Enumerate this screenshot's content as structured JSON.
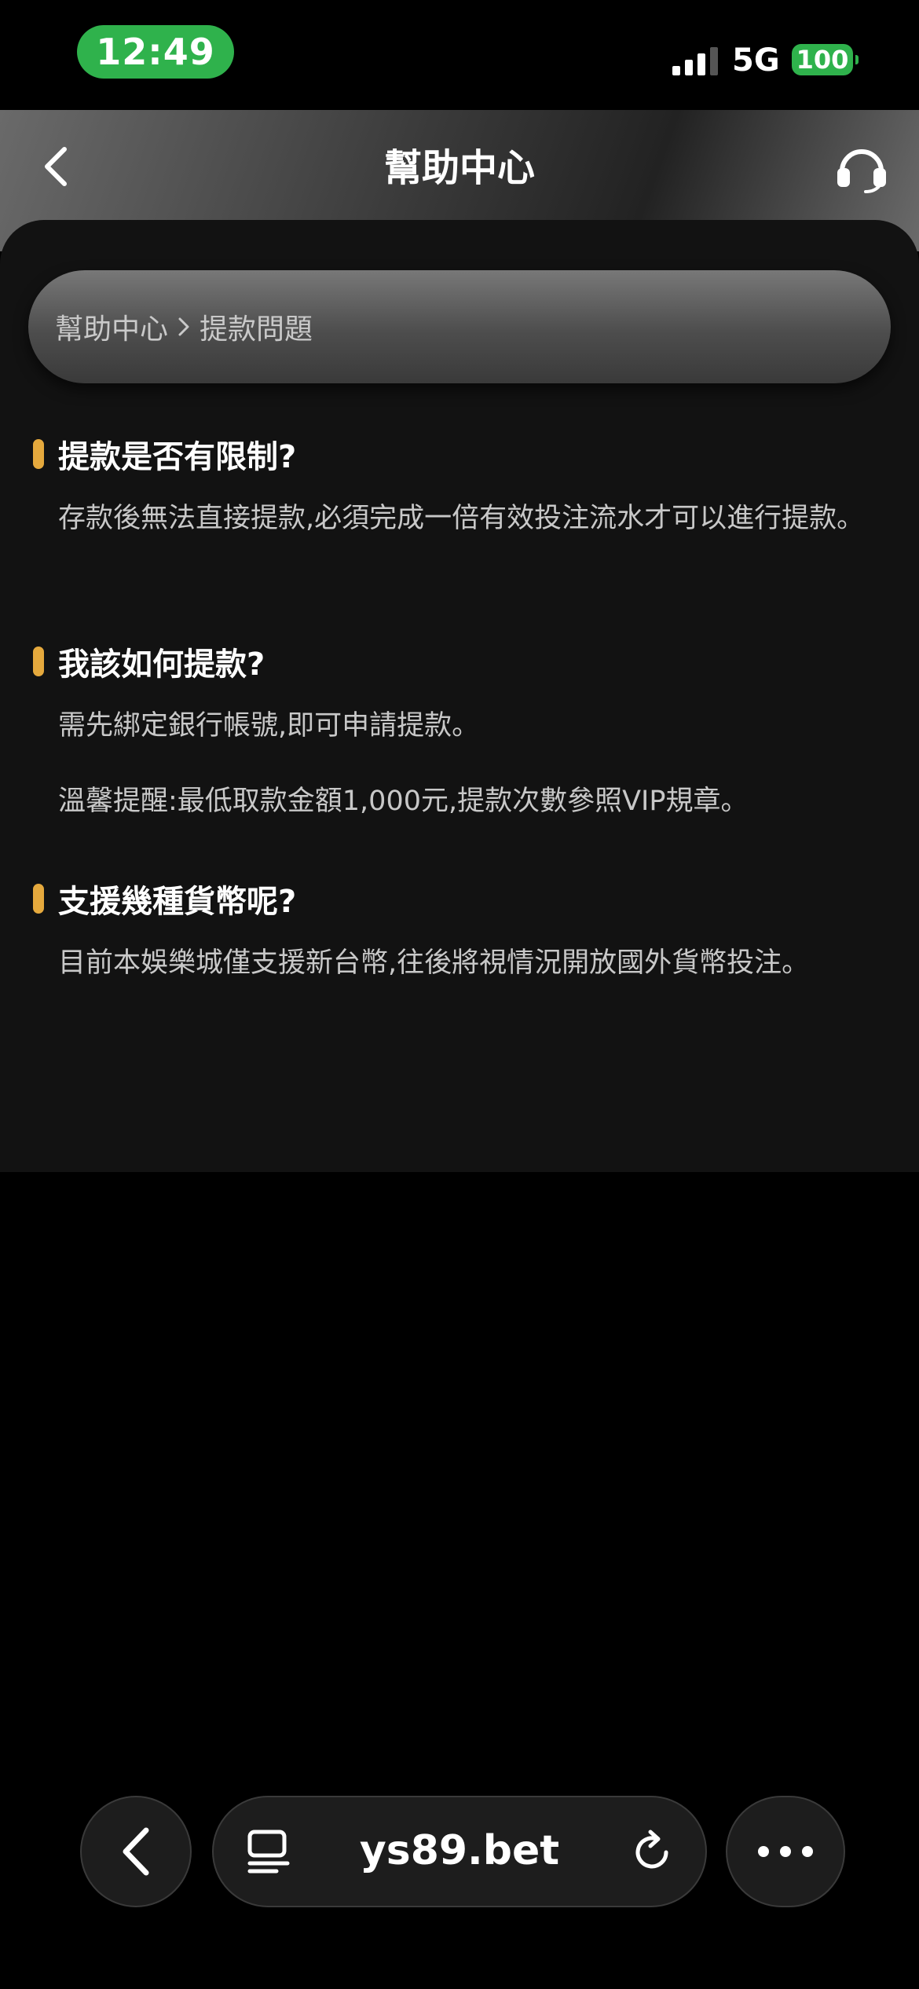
{
  "status_bar": {
    "time": "12:49",
    "network": "5G",
    "battery": "100",
    "signal_bars": 3
  },
  "header": {
    "title": "幫助中心",
    "back_icon": "chevron-left-icon",
    "support_icon": "headset-icon"
  },
  "breadcrumb": {
    "root": "幫助中心",
    "separator_icon": "chevron-right-icon",
    "current": "提款問題"
  },
  "faq": [
    {
      "question": "提款是否有限制?",
      "answer": "存款後無法直接提款,必須完成一倍有效投注流水才可以進行提款。"
    },
    {
      "question": "我該如何提款?",
      "answer": "需先綁定銀行帳號,即可申請提款。",
      "extra": "溫馨提醒:最低取款金額1,000元,提款次數參照VIP規章。"
    },
    {
      "question": "支援幾種貨幣呢?",
      "answer": "目前本娛樂城僅支援新台幣,往後將視情況開放國外貨幣投注。"
    }
  ],
  "browser_bar": {
    "url": "ys89.bet",
    "back_icon": "chevron-left-icon",
    "tabs_icon": "tabs-icon",
    "reload_icon": "reload-icon",
    "more_icon": "more-icon"
  },
  "colors": {
    "accent": "#e5a93d",
    "status_green": "#2fb24c",
    "content_bg": "#121212"
  }
}
